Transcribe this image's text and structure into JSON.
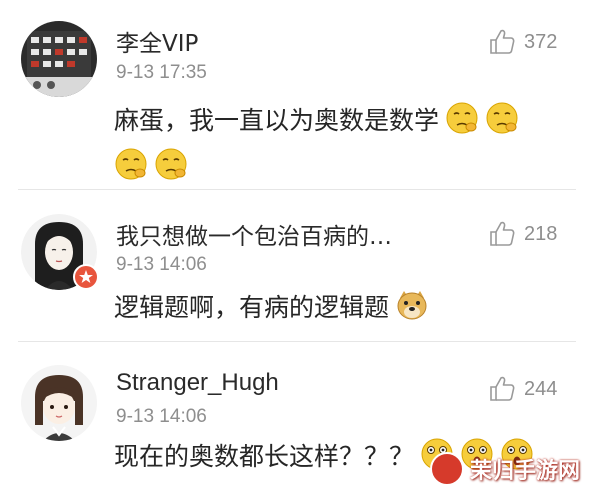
{
  "comments": [
    {
      "username": "李全VIP",
      "time": "9-13 17:35",
      "likes": "372",
      "text": "麻蛋，我一直以为奥数是数学",
      "emojis": [
        "pensive-face-emoji",
        "pensive-face-emoji",
        "pensive-face-emoji",
        "pensive-face-emoji"
      ]
    },
    {
      "username": "我只想做一个包治百病的…",
      "time": "9-13 14:06",
      "likes": "218",
      "text": "逻辑题啊，有病的逻辑题",
      "emojis": [
        "doge-emoji"
      ]
    },
    {
      "username": "Stranger_Hugh",
      "time": "9-13 14:06",
      "likes": "244",
      "text": "现在的奥数都长这样？？？",
      "emojis": [
        "shocked-face-emoji",
        "shocked-face-emoji",
        "shocked-face-emoji"
      ]
    }
  ],
  "watermark": "茉归手游网",
  "colors": {
    "text": "#262626",
    "meta": "#8e8e8e",
    "divider": "#e6e6e6",
    "emoji_yellow": "#f6cd3c",
    "badge_red": "#d63a2b"
  }
}
